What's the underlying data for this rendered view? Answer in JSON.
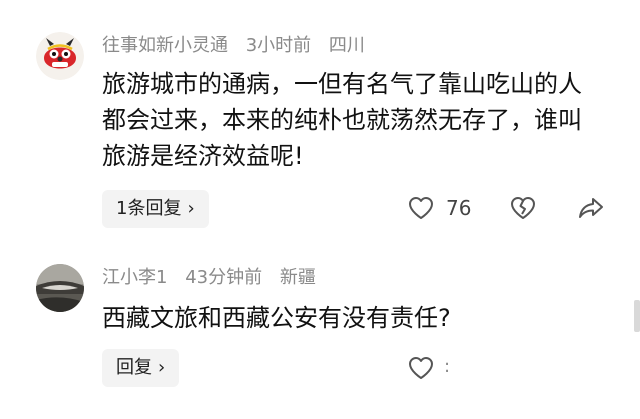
{
  "comments": [
    {
      "username": "往事如新小灵通",
      "time": "3小时前",
      "location": "四川",
      "text": "旅游城市的通病，一但有名气了靠山吃山的人都会过来，本来的纯朴也就荡然无存了，谁叫旅游是经济效益呢!",
      "reply_label": "1条回复",
      "like_count": "76",
      "avatar_icon": "lion-dance-avatar"
    },
    {
      "username": "江小李1",
      "time": "43分钟前",
      "location": "新疆",
      "text": "西藏文旅和西藏公安有没有责任?",
      "reply_label": "回复",
      "avatar_icon": "landscape-avatar"
    }
  ],
  "icons": {
    "like": "heart-outline-icon",
    "dislike": "broken-heart-icon",
    "share": "share-arrow-icon",
    "chevron": "chevron-right-icon"
  },
  "colors": {
    "meta": "#8a8a8a",
    "button_bg": "#f3f3f3",
    "icon": "#555555"
  }
}
